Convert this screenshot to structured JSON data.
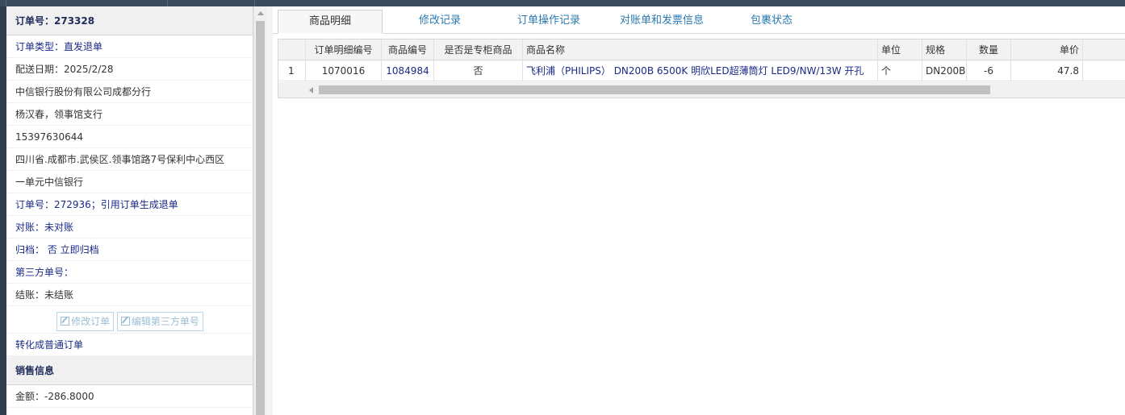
{
  "order": {
    "title": "订单号：273328",
    "type": "订单类型：直发退单",
    "delivery_date": "配送日期：2025/2/28",
    "company": "中信银行股份有限公司成都分行",
    "contact": "杨汉春，领事馆支行",
    "phone": "15397630644",
    "address_line1": "四川省.成都市.武侯区.领事馆路7号保利中心西区",
    "address_line2": "一单元中信银行",
    "ref_order": "订单号：272936；引用订单生成退单",
    "reconcile": "对账：未对账",
    "archive": "归档： 否 立即归档",
    "third_party": "第三方单号：",
    "settle": "结账：未结账",
    "btn_edit_order": "修改订单",
    "btn_edit_third": "编辑第三方单号",
    "convert": "转化成普通订单"
  },
  "sales": {
    "title": "销售信息",
    "amount": "金额：-286.8000"
  },
  "tabs": [
    "商品明细",
    "修改记录",
    "订单操作记录",
    "对账单和发票信息",
    "包裹状态"
  ],
  "grid": {
    "columns": [
      "订单明细编号",
      "商品编号",
      "是否是专柜商品",
      "商品名称",
      "单位",
      "规格",
      "数量",
      "单价"
    ],
    "rows": [
      {
        "rownum": "1",
        "detail_id": "1070016",
        "product_id": "1084984",
        "counter": "否",
        "name": "飞利浦（PHILIPS） DN200B 6500K 明欣LED超薄筒灯 LED9/NW/13W 开孔",
        "unit": "个",
        "spec": "DN200B",
        "qty": "-6",
        "price": "47.8"
      }
    ]
  },
  "colors": {
    "topbar": "#3b4a5c",
    "link": "#1a2a88",
    "tab": "#2a7ab0"
  }
}
